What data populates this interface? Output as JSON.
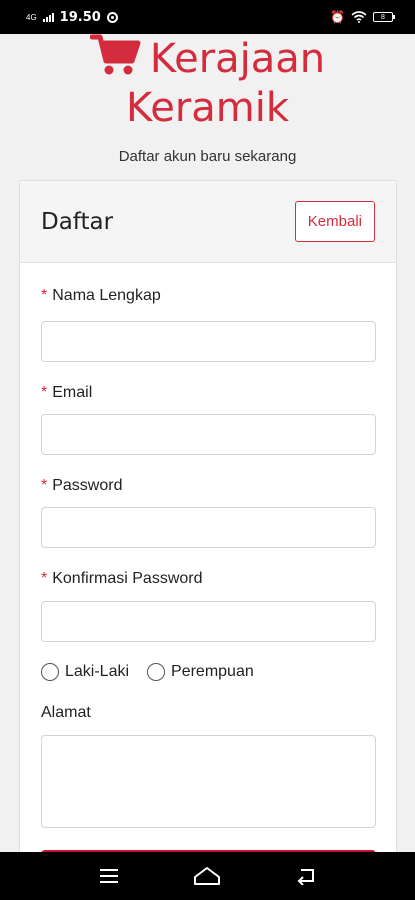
{
  "status_bar": {
    "time": "19.50",
    "signal_label": "4G",
    "battery_level": "8"
  },
  "brand": {
    "name_line1": "Kerajaan",
    "name_line2": "Keramik",
    "icon": "shopping-cart-icon",
    "color": "#d42c3d"
  },
  "subtitle": "Daftar akun baru sekarang",
  "card": {
    "title": "Daftar",
    "back_button": "Kembali"
  },
  "form": {
    "required_mark": "*",
    "fields": [
      {
        "label": "Nama Lengkap",
        "value": "",
        "required": true
      },
      {
        "label": "Email",
        "value": "",
        "required": true
      },
      {
        "label": "Password",
        "value": "",
        "required": true
      },
      {
        "label": "Konfirmasi Password",
        "value": "",
        "required": true
      }
    ],
    "gender": {
      "options": [
        "Laki-Laki",
        "Perempuan"
      ],
      "selected": null
    },
    "address": {
      "label": "Alamat",
      "value": ""
    }
  },
  "nav_bar": {
    "icons": [
      "menu-icon",
      "home-icon",
      "back-icon"
    ]
  }
}
